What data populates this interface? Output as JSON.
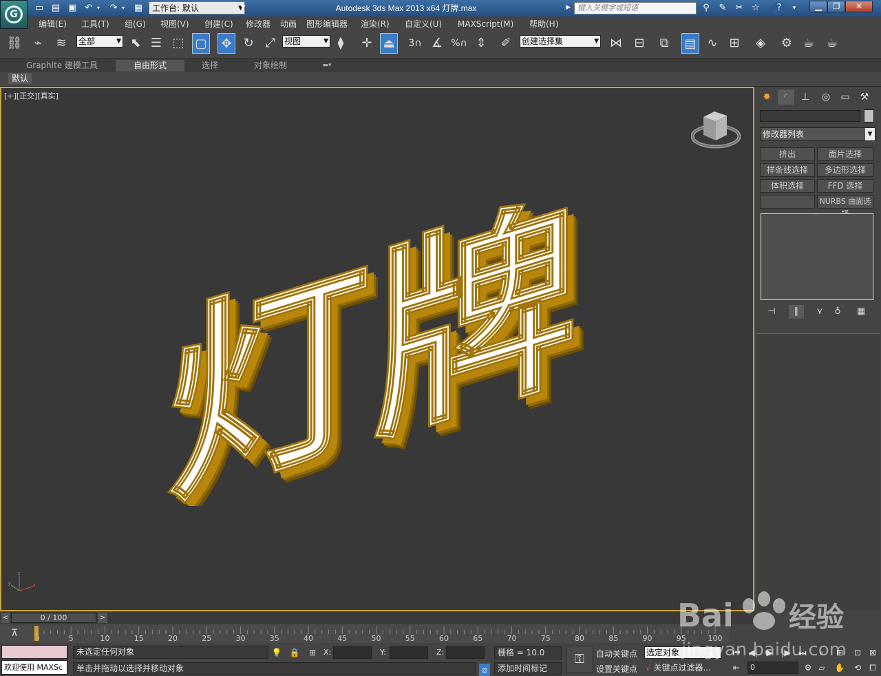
{
  "titlebar": {
    "workspace_label": "工作台: 默认",
    "title": "Autodesk 3ds Max  2013 x64       灯牌.max",
    "search_placeholder": "键入关键字或短语"
  },
  "menu": [
    "编辑(E)",
    "工具(T)",
    "组(G)",
    "视图(V)",
    "创建(C)",
    "修改器",
    "动画",
    "图形编辑器",
    "渲染(R)",
    "自定义(U)",
    "MAXScript(M)",
    "帮助(H)"
  ],
  "toolbar": {
    "selection_filter": "全部",
    "ref_coord": "视图",
    "named_selection": "创建选择集",
    "snap_labels": [
      "3",
      "%"
    ]
  },
  "ribbon": {
    "tabs": [
      "Graphite 建模工具",
      "自由形式",
      "选择",
      "对象绘制"
    ],
    "active_tab": "自由形式",
    "panel_label": "默认"
  },
  "viewport": {
    "label": "[+][正交][真实]",
    "scene_text": "灯牌",
    "face_color": "#ffffff",
    "extrude_color": "#b8860b",
    "border_color": "#c9a23a"
  },
  "command_panel": {
    "modifier_list": "修改器列表",
    "buttons": [
      "挤出",
      "面片选择",
      "样条线选择",
      "多边形选择",
      "体积选择",
      "FFD 选择",
      "",
      "NURBS 曲面选择"
    ]
  },
  "timeslider": {
    "position": "0 / 100",
    "ticks": [
      "0",
      "5",
      "10",
      "15",
      "20",
      "25",
      "30",
      "35",
      "40",
      "45",
      "50",
      "55",
      "60",
      "65",
      "70",
      "75",
      "80",
      "85",
      "90",
      "95",
      "100"
    ]
  },
  "status": {
    "maxscript_text": "欢迎使用 MAXSc",
    "selection_status": "未选定任何对象",
    "prompt": "单击并拖动以选择并移动对象",
    "x_label": "X:",
    "y_label": "Y:",
    "z_label": "Z:",
    "grid": "栅格 = 10.0",
    "add_time_tag": "添加时间标记",
    "auto_key": "自动关键点",
    "set_key": "设置关键点",
    "key_mode": "选定对象",
    "key_filters": "关键点过滤器...",
    "current_frame": "0"
  },
  "watermark": {
    "brand": "Bai",
    "brand_cn": "经验",
    "url": "jingyan.baidu.com"
  }
}
